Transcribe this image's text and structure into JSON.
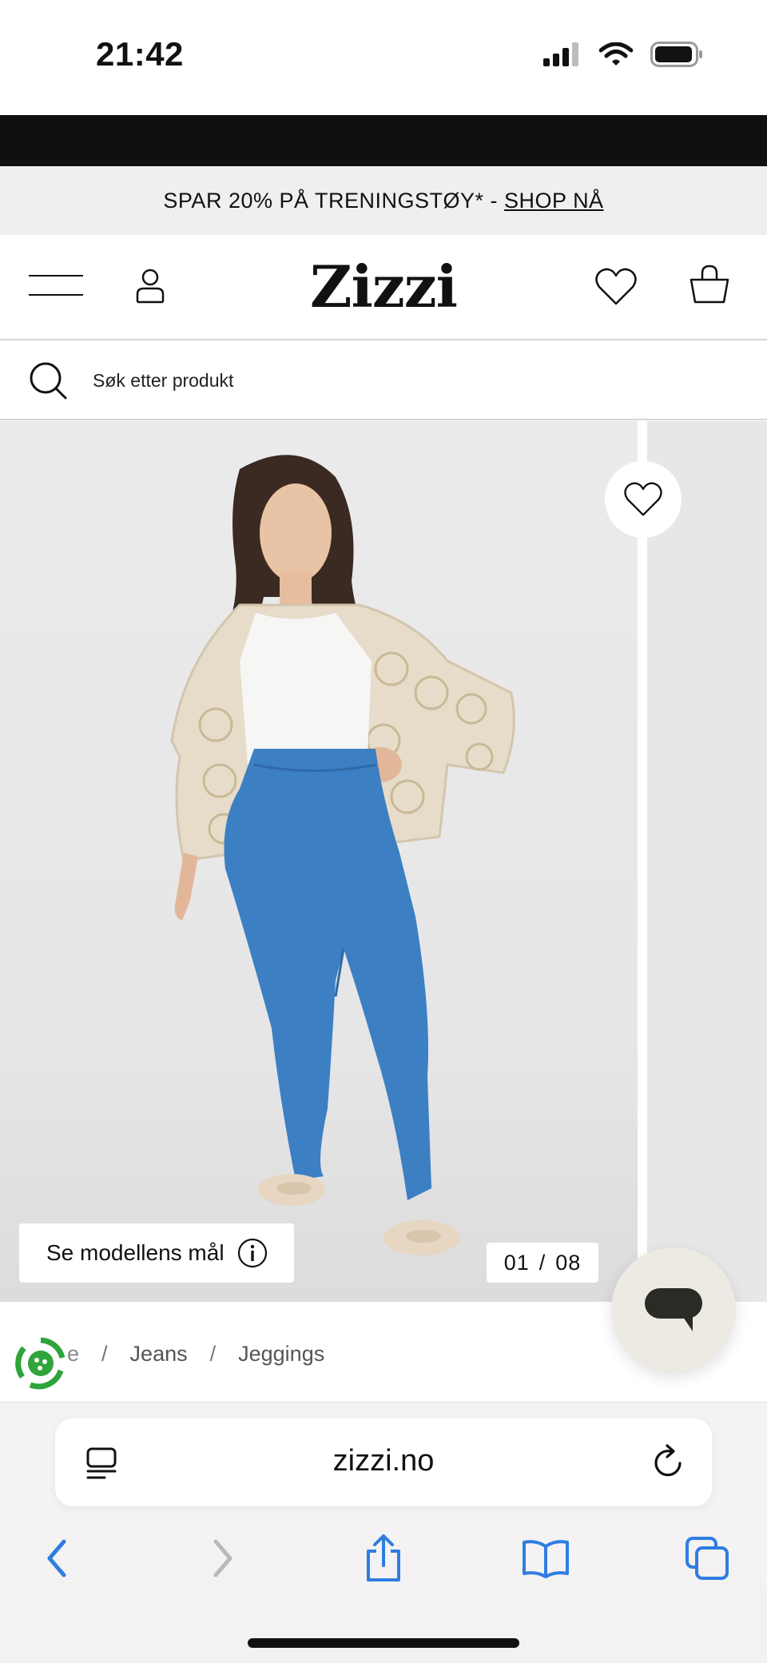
{
  "status_bar": {
    "time": "21:42"
  },
  "promo": {
    "text": "SPAR 20% PÅ TRENINGSTØY* -",
    "link": "SHOP NÅ"
  },
  "header": {
    "logo": "Zizzi"
  },
  "search": {
    "placeholder": "Søk etter produkt"
  },
  "gallery": {
    "measure_label": "Se modellens mål",
    "counter_current": "01",
    "counter_separator": "/",
    "counter_total": "08"
  },
  "breadcrumb": {
    "partial": "e",
    "items": [
      "Jeans",
      "Jeggings"
    ],
    "separator": "/"
  },
  "browser": {
    "url": "zizzi.no"
  },
  "colors": {
    "accent_blue": "#2f7de1",
    "promo_bg": "#efefef",
    "eco_green": "#2ea43a",
    "jeans_blue": "#3c7fc3"
  },
  "icons": [
    "hamburger-icon",
    "account-icon",
    "heart-icon",
    "bag-icon",
    "search-icon",
    "info-icon",
    "chat-icon",
    "eco-badge-icon",
    "tabs-icon",
    "reload-icon",
    "back-icon",
    "forward-icon",
    "share-icon",
    "bookmarks-icon",
    "tabs-overview-icon"
  ]
}
